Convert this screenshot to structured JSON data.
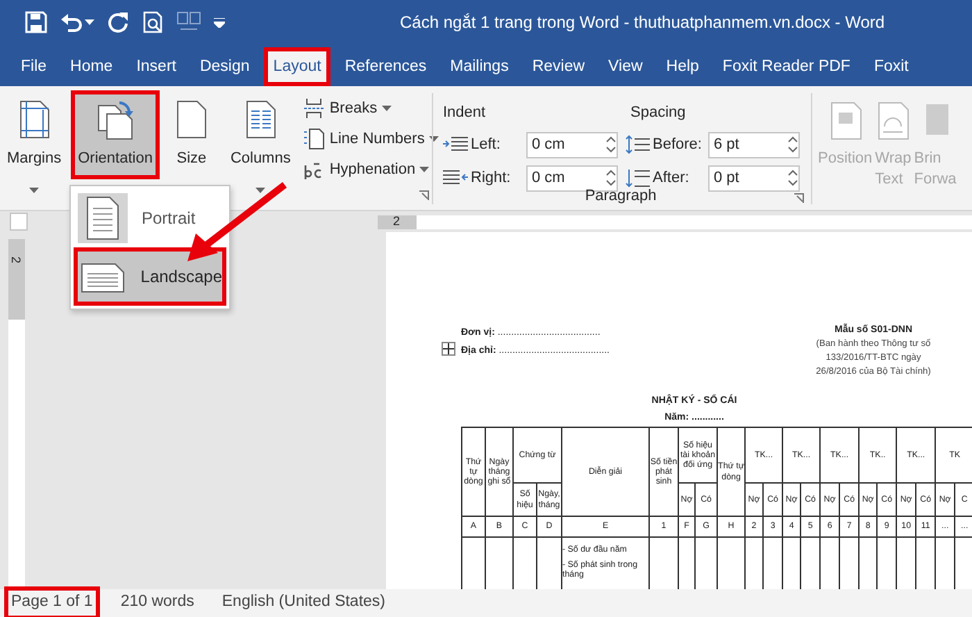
{
  "window": {
    "title": "Cách ngắt 1 trang trong Word - thuthuatphanmem.vn.docx - Word"
  },
  "tabs": [
    {
      "label": "File",
      "selected": false,
      "highlighted": false
    },
    {
      "label": "Home",
      "selected": false,
      "highlighted": false
    },
    {
      "label": "Insert",
      "selected": false,
      "highlighted": false
    },
    {
      "label": "Design",
      "selected": false,
      "highlighted": false
    },
    {
      "label": "Layout",
      "selected": true,
      "highlighted": true
    },
    {
      "label": "References",
      "selected": false,
      "highlighted": false
    },
    {
      "label": "Mailings",
      "selected": false,
      "highlighted": false
    },
    {
      "label": "Review",
      "selected": false,
      "highlighted": false
    },
    {
      "label": "View",
      "selected": false,
      "highlighted": false
    },
    {
      "label": "Help",
      "selected": false,
      "highlighted": false
    },
    {
      "label": "Foxit Reader PDF",
      "selected": false,
      "highlighted": false
    },
    {
      "label": "Foxit",
      "selected": false,
      "highlighted": false
    }
  ],
  "page_setup": {
    "buttons": [
      {
        "kind": "margins",
        "label": "Margins",
        "selected": false,
        "highlighted": false
      },
      {
        "kind": "orientation",
        "label": "Orientation",
        "selected": true,
        "highlighted": true
      },
      {
        "kind": "size",
        "label": "Size",
        "selected": false,
        "highlighted": false
      },
      {
        "kind": "columns",
        "label": "Columns",
        "selected": false,
        "highlighted": false
      }
    ],
    "commands": [
      {
        "kind": "breaks",
        "label": "Breaks"
      },
      {
        "kind": "line_numbers",
        "label": "Line Numbers"
      },
      {
        "kind": "hyphenation",
        "label": "Hyphenation"
      }
    ]
  },
  "paragraph": {
    "indent_heading": "Indent",
    "spacing_heading": "Spacing",
    "indent": [
      {
        "kind": "left",
        "label": "Left:",
        "value": "0 cm"
      },
      {
        "kind": "right",
        "label": "Right:",
        "value": "0 cm"
      }
    ],
    "spacing": [
      {
        "kind": "before",
        "label": "Before:",
        "value": "6 pt"
      },
      {
        "kind": "after",
        "label": "After:",
        "value": "0 pt"
      }
    ],
    "group_label": "Paragraph"
  },
  "arrange": [
    {
      "kind": "position",
      "lines": [
        "Position"
      ],
      "disabled": true
    },
    {
      "kind": "wrap",
      "lines": [
        "Wrap",
        "Text"
      ],
      "disabled": true
    },
    {
      "kind": "bring",
      "lines": [
        "Brin",
        "Forwa"
      ],
      "disabled": true
    }
  ],
  "orientation_menu": [
    {
      "kind": "portrait",
      "label": "Portrait",
      "selected": false,
      "highlighted": false
    },
    {
      "kind": "landscape",
      "label": "Landscape",
      "selected": true,
      "highlighted": true
    }
  ],
  "rulers": {
    "horizontal_number": "2",
    "vertical_number": "2"
  },
  "document": {
    "unit": "**Đơn vị:** ......................................",
    "address": "**Địa chỉ:** .........................................",
    "form_lines": [
      "Mẫu số S01-DNN",
      "(Ban hành theo Thông tư số",
      "133/2016/TT-BTC ngày",
      "26/8/2016 của Bộ Tài chính)"
    ],
    "title": "NHẬT KÝ - SỔ CÁI",
    "year": "**Năm:** ............",
    "table": {
      "line_no": "Thứ tự dòng",
      "date": "Ngày tháng ghi sổ",
      "voucher": {
        "title": "Chứng từ",
        "number": "Số hiệu",
        "date": "Ngày, tháng"
      },
      "description": "Diễn giải",
      "amount": "Số tiền phát sinh",
      "contra_account": {
        "title": "Số hiệu tài khoản đối ứng",
        "debit": "Nợ",
        "credit": "Có"
      },
      "line_no_2": "Thứ tự dòng",
      "accounts": [
        {
          "title": "TK...",
          "debit": "Nợ",
          "credit": "Có"
        },
        {
          "title": "TK...",
          "debit": "Nợ",
          "credit": "Có"
        },
        {
          "title": "TK...",
          "debit": "Nợ",
          "credit": "Có"
        },
        {
          "title": "TK..",
          "debit": "Nợ",
          "credit": "Có"
        },
        {
          "title": "TK...",
          "debit": "Nợ",
          "credit": "Có"
        },
        {
          "title": "TK",
          "debit": "Nợ",
          "credit": "C"
        }
      ],
      "index_row": [
        "A",
        "B",
        "C",
        "D",
        "E",
        "1",
        "F",
        "G",
        "H",
        "2",
        "3",
        "4",
        "5",
        "6",
        "7",
        "8",
        "9",
        "10",
        "11",
        "...",
        "..."
      ],
      "description_lines": [
        "- Số dư đầu năm",
        "- Số phát sinh trong tháng"
      ]
    }
  },
  "status_bar": [
    {
      "text": "Page 1 of 1",
      "highlighted": true
    },
    {
      "text": "210 words",
      "highlighted": false
    },
    {
      "text": "English (United States)",
      "highlighted": false
    }
  ]
}
